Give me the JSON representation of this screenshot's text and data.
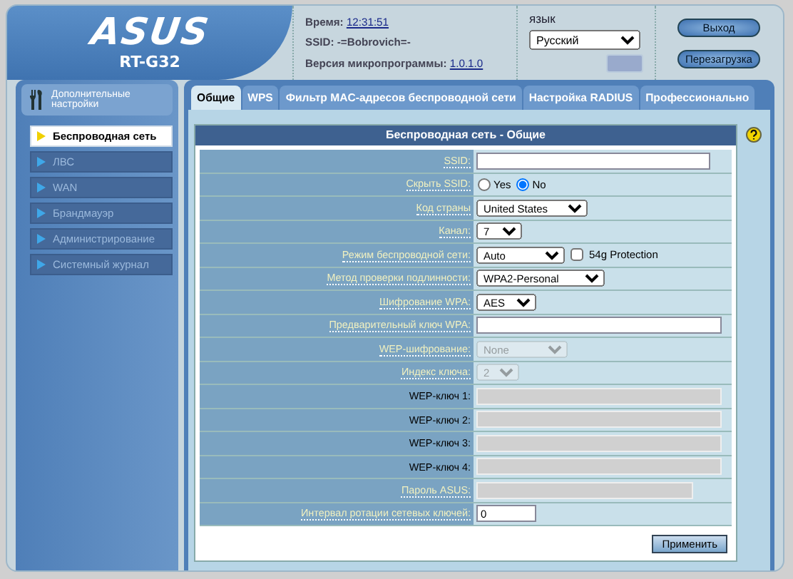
{
  "header": {
    "brand": "ASUS",
    "model": "RT-G32",
    "time_label": "Время:",
    "time": "12:31:51",
    "ssid_label": "SSID:",
    "ssid": "-=Bobrovich=-",
    "firmware_label": "Версия микропрограммы:",
    "firmware": "1.0.1.0",
    "language_label": "язык",
    "language": "Русский",
    "buttons": [
      "Выход",
      "Перезагрузка"
    ]
  },
  "sidebar": {
    "title": "Дополнительные настройки",
    "items": [
      {
        "label": "Беспроводная сеть",
        "selected": true
      },
      {
        "label": "ЛВС",
        "selected": false
      },
      {
        "label": "WAN",
        "selected": false
      },
      {
        "label": "Брандмауэр",
        "selected": false
      },
      {
        "label": "Администрирование",
        "selected": false
      },
      {
        "label": "Системный журнал",
        "selected": false
      }
    ]
  },
  "tabs": [
    {
      "label": "Общие",
      "selected": true
    },
    {
      "label": "WPS",
      "selected": false
    },
    {
      "label": "Фильтр MAC-адресов беспроводной сети",
      "selected": false
    },
    {
      "label": "Настройка RADIUS",
      "selected": false
    },
    {
      "label": "Профессионально",
      "selected": false
    }
  ],
  "panel": {
    "title": "Беспроводная сеть - Общие",
    "rows": [
      {
        "label": "SSID:",
        "hint": true,
        "kind": "text",
        "value": "",
        "disabled": false
      },
      {
        "label": "Скрыть SSID:",
        "hint": true,
        "kind": "radio",
        "options": [
          {
            "label": "Yes",
            "selected": false
          },
          {
            "label": "No",
            "selected": true
          }
        ]
      },
      {
        "label": "Код страны",
        "hint": true,
        "kind": "select",
        "value": "United States",
        "disabled": false
      },
      {
        "label": "Канал:",
        "hint": true,
        "kind": "select",
        "value": "7",
        "disabled": false
      },
      {
        "label": "Режим беспроводной сети:",
        "hint": true,
        "kind": "select",
        "value": "Auto",
        "disabled": false,
        "checkbox": {
          "label": "54g Protection",
          "checked": false
        }
      },
      {
        "label": "Метод проверки подлинности:",
        "hint": true,
        "kind": "select",
        "value": "WPA2-Personal",
        "disabled": false
      },
      {
        "label": "Шифрование WPA:",
        "hint": true,
        "kind": "select",
        "value": "AES",
        "disabled": false
      },
      {
        "label": "Предварительный ключ WPA:",
        "hint": true,
        "kind": "text",
        "value": "",
        "disabled": false
      },
      {
        "label": "WEP-шифрование:",
        "hint": true,
        "kind": "select",
        "value": "None",
        "disabled": true
      },
      {
        "label": "Индекс ключа:",
        "hint": true,
        "kind": "select",
        "value": "2",
        "disabled": true
      },
      {
        "label": "WEP-ключ 1:",
        "hint": false,
        "kind": "text",
        "value": "",
        "disabled": true
      },
      {
        "label": "WEP-ключ 2:",
        "hint": false,
        "kind": "text",
        "value": "",
        "disabled": true
      },
      {
        "label": "WEP-ключ 3:",
        "hint": false,
        "kind": "text",
        "value": "",
        "disabled": true
      },
      {
        "label": "WEP-ключ 4:",
        "hint": false,
        "kind": "text",
        "value": "",
        "disabled": true
      },
      {
        "label": "Пароль ASUS:",
        "hint": true,
        "kind": "text",
        "value": "",
        "disabled": true
      },
      {
        "label": "Интервал ротации сетевых ключей:",
        "hint": true,
        "kind": "text",
        "value": "0",
        "disabled": false
      }
    ],
    "apply": "Применить"
  }
}
